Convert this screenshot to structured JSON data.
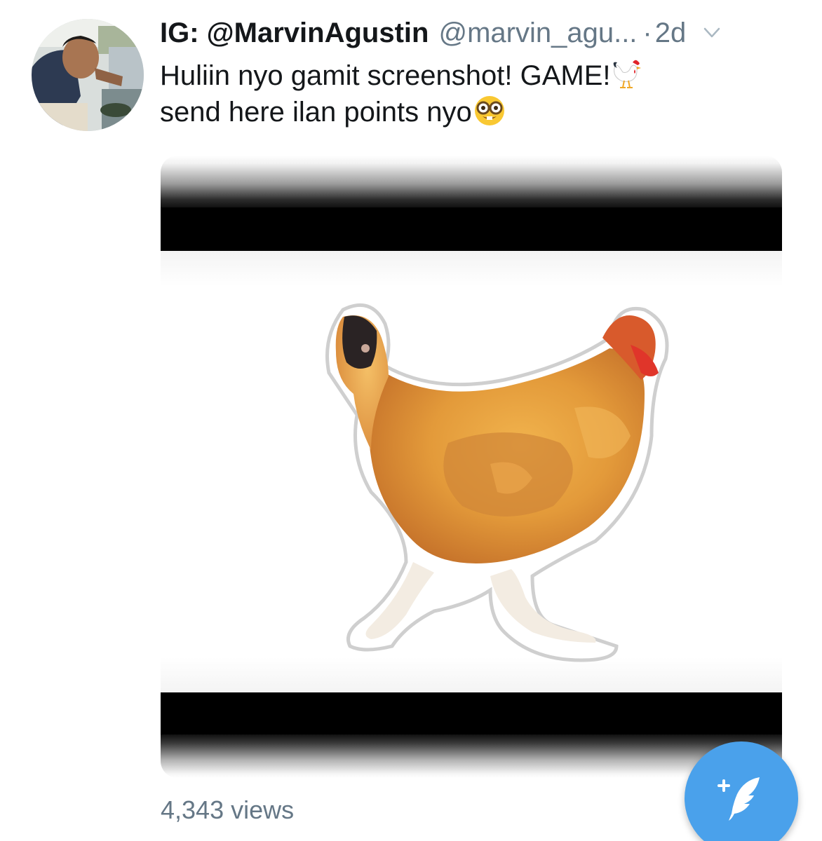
{
  "tweet": {
    "display_name": "IG: @MarvinAgustin",
    "handle": "@marvin_agu...",
    "separator": "·",
    "time": "2d",
    "text_line1": "Huliin nyo gamit screenshot! GAME!",
    "text_line2": "send here ilan points nyo",
    "emoji_1": "rooster-emoji",
    "emoji_2": "nerd-face-emoji",
    "views": "4,343 views"
  },
  "icons": {
    "chevron": "chevron-down-icon",
    "compose": "compose-tweet-icon"
  },
  "colors": {
    "accent": "#4aa1eb",
    "secondary_text": "#657786",
    "primary_text": "#14171a"
  }
}
